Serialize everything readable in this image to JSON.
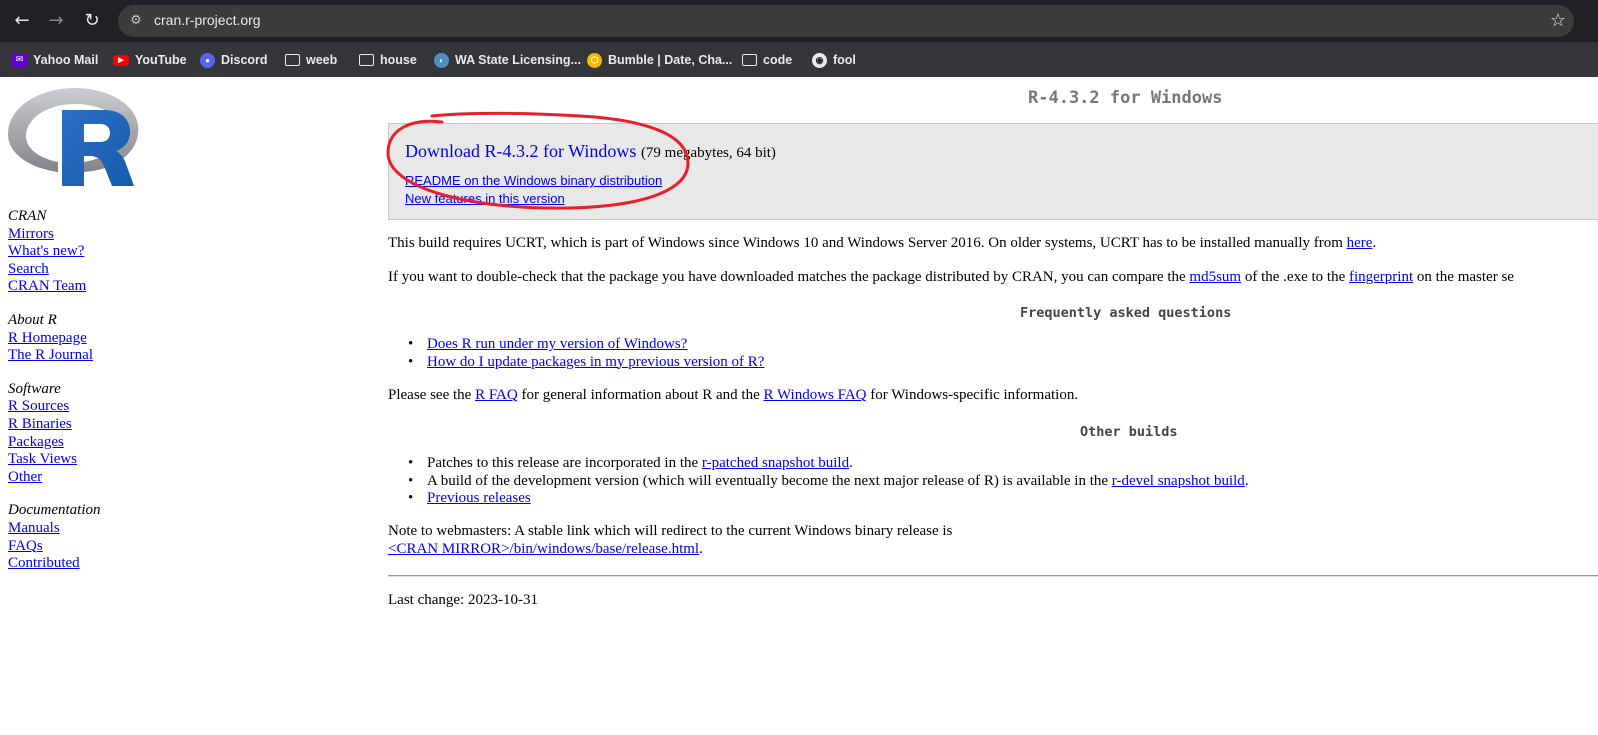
{
  "browser": {
    "url": "cran.r-project.org",
    "bookmarks": [
      {
        "label": "Yahoo Mail",
        "icon": "yahoo-mail-icon"
      },
      {
        "label": "YouTube",
        "icon": "youtube-icon"
      },
      {
        "label": "Discord",
        "icon": "discord-icon"
      },
      {
        "label": "weeb",
        "icon": "folder-icon"
      },
      {
        "label": "house",
        "icon": "folder-icon"
      },
      {
        "label": "WA State Licensing...",
        "icon": "wa-state-icon"
      },
      {
        "label": "Bumble | Date, Cha...",
        "icon": "bumble-icon"
      },
      {
        "label": "code",
        "icon": "folder-icon"
      },
      {
        "label": "fool",
        "icon": "github-icon"
      }
    ]
  },
  "sidebar": {
    "sections": [
      {
        "header": "CRAN",
        "links": [
          "Mirrors",
          "What's new?",
          "Search",
          "CRAN Team"
        ]
      },
      {
        "header": "About R",
        "links": [
          "R Homepage",
          "The R Journal"
        ]
      },
      {
        "header": "Software",
        "links": [
          "R Sources",
          "R Binaries",
          "Packages",
          "Task Views",
          "Other"
        ]
      },
      {
        "header": "Documentation",
        "links": [
          "Manuals",
          "FAQs",
          "Contributed"
        ]
      }
    ]
  },
  "main": {
    "title": "R-4.3.2 for Windows",
    "download_link": "Download R-4.3.2 for Windows",
    "download_size": "(79 megabytes, 64 bit)",
    "readme_link": "README on the Windows binary distribution",
    "new_features_link": "New features in this version",
    "ucrt_text": "This build requires UCRT, which is part of Windows since Windows 10 and Windows Server 2016. On older systems, UCRT has to be installed manually from",
    "ucrt_link": "here",
    "md5_text_1": "If you want to double-check that the package you have downloaded matches the package distributed by CRAN, you can compare the",
    "md5_link": "md5sum",
    "md5_text_2": "of the .exe to the",
    "fingerprint_link": "fingerprint",
    "md5_text_3": "on the master se",
    "faq_heading": "Frequently asked questions",
    "faq_items": [
      "Does R run under my version of Windows?",
      "How do I update packages in my previous version of R?"
    ],
    "see_text_1": "Please see the",
    "rfaq_link": "R FAQ",
    "see_text_2": "for general information about R and the",
    "rwinfaq_link": "R Windows FAQ",
    "see_text_3": "for Windows-specific information.",
    "other_heading": "Other builds",
    "other_1_text": "Patches to this release are incorporated in the",
    "other_1_link": "r-patched snapshot build",
    "other_2_text": "A build of the development version (which will eventually become the next major release of R) is available in the",
    "other_2_link": "r-devel snapshot build",
    "other_3_link": "Previous releases",
    "note_text": "Note to webmasters: A stable link which will redirect to the current Windows binary release is",
    "note_link": "<CRAN MIRROR>/bin/windows/base/release.html",
    "last_change": "Last change: 2023-10-31"
  },
  "annotation_color": "#e8202a"
}
